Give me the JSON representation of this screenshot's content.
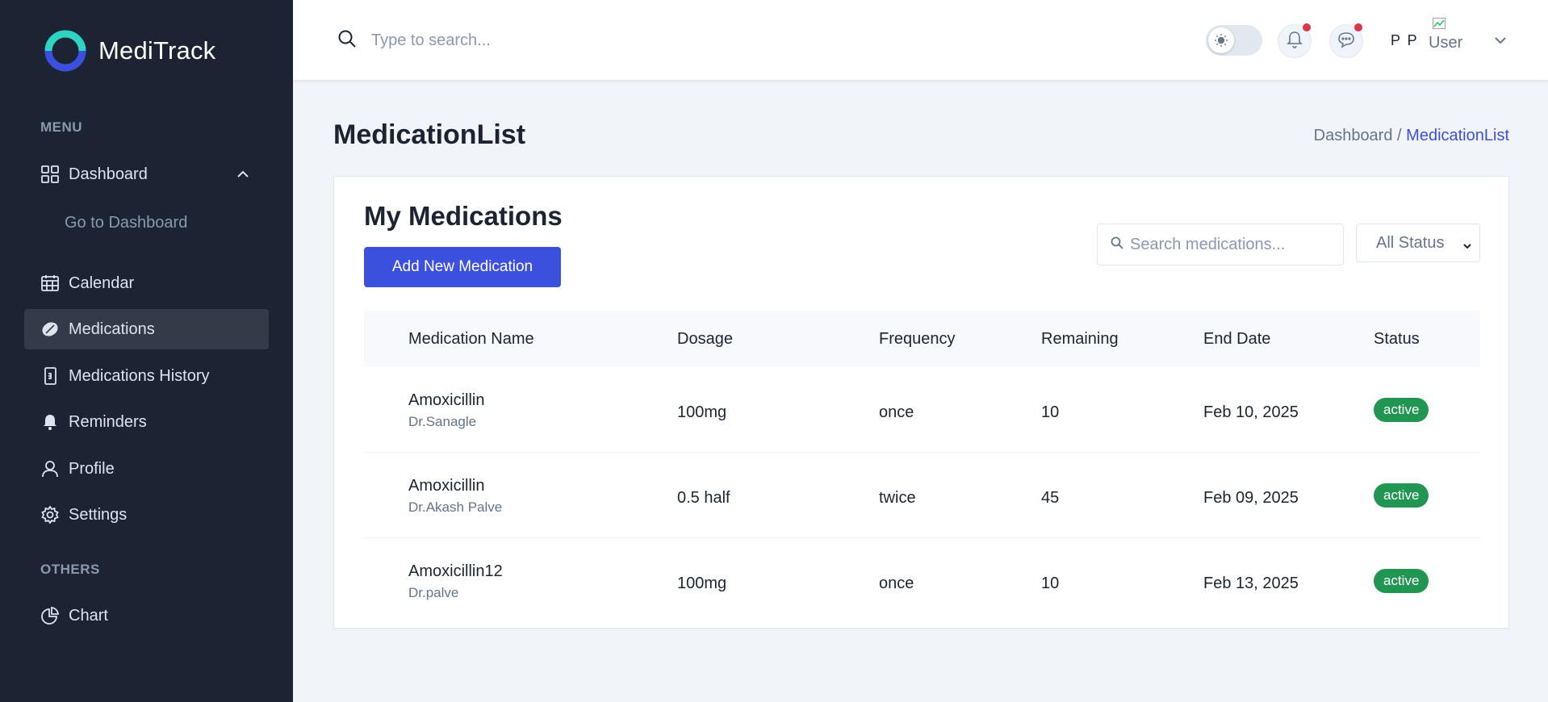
{
  "app": {
    "name": "MediTrack"
  },
  "sidebar": {
    "menu_heading": "MENU",
    "others_heading": "OTHERS",
    "items": [
      {
        "label": "Dashboard",
        "icon": "grid-icon"
      },
      {
        "label": "Go to Dashboard"
      },
      {
        "label": "Calendar",
        "icon": "calendar-icon"
      },
      {
        "label": "Medications",
        "icon": "pill-icon",
        "active": true
      },
      {
        "label": "Medications History",
        "icon": "history-icon"
      },
      {
        "label": "Reminders",
        "icon": "bell-icon"
      },
      {
        "label": "Profile",
        "icon": "user-icon"
      },
      {
        "label": "Settings",
        "icon": "gear-icon"
      },
      {
        "label": "Chart",
        "icon": "pie-chart-icon"
      }
    ]
  },
  "header": {
    "search_placeholder": "Type to search...",
    "user_initials": "P P",
    "user_image_alt": "User"
  },
  "page": {
    "title": "MedicationList",
    "breadcrumb": {
      "root": "Dashboard /",
      "current": "MedicationList"
    }
  },
  "card": {
    "title": "My Medications",
    "add_button": "Add New Medication",
    "search_placeholder": "Search medications...",
    "status_filter": "All Status",
    "columns": [
      "Medication Name",
      "Dosage",
      "Frequency",
      "Remaining",
      "End Date",
      "Status"
    ],
    "rows": [
      {
        "name": "Amoxicillin",
        "doctor": "Dr.Sanagle",
        "dosage": "100mg",
        "frequency": "once",
        "remaining": "10",
        "end_date": "Feb 10, 2025",
        "status": "active"
      },
      {
        "name": "Amoxicillin",
        "doctor": "Dr.Akash Palve",
        "dosage": "0.5 half",
        "frequency": "twice",
        "remaining": "45",
        "end_date": "Feb 09, 2025",
        "status": "active"
      },
      {
        "name": "Amoxicillin12",
        "doctor": "Dr.palve",
        "dosage": "100mg",
        "frequency": "once",
        "remaining": "10",
        "end_date": "Feb 13, 2025",
        "status": "active"
      }
    ]
  },
  "colors": {
    "sidebar_bg": "#1c2434",
    "primary": "#3c50e0",
    "active_badge": "#219653",
    "notification_dot": "#dc3545"
  }
}
